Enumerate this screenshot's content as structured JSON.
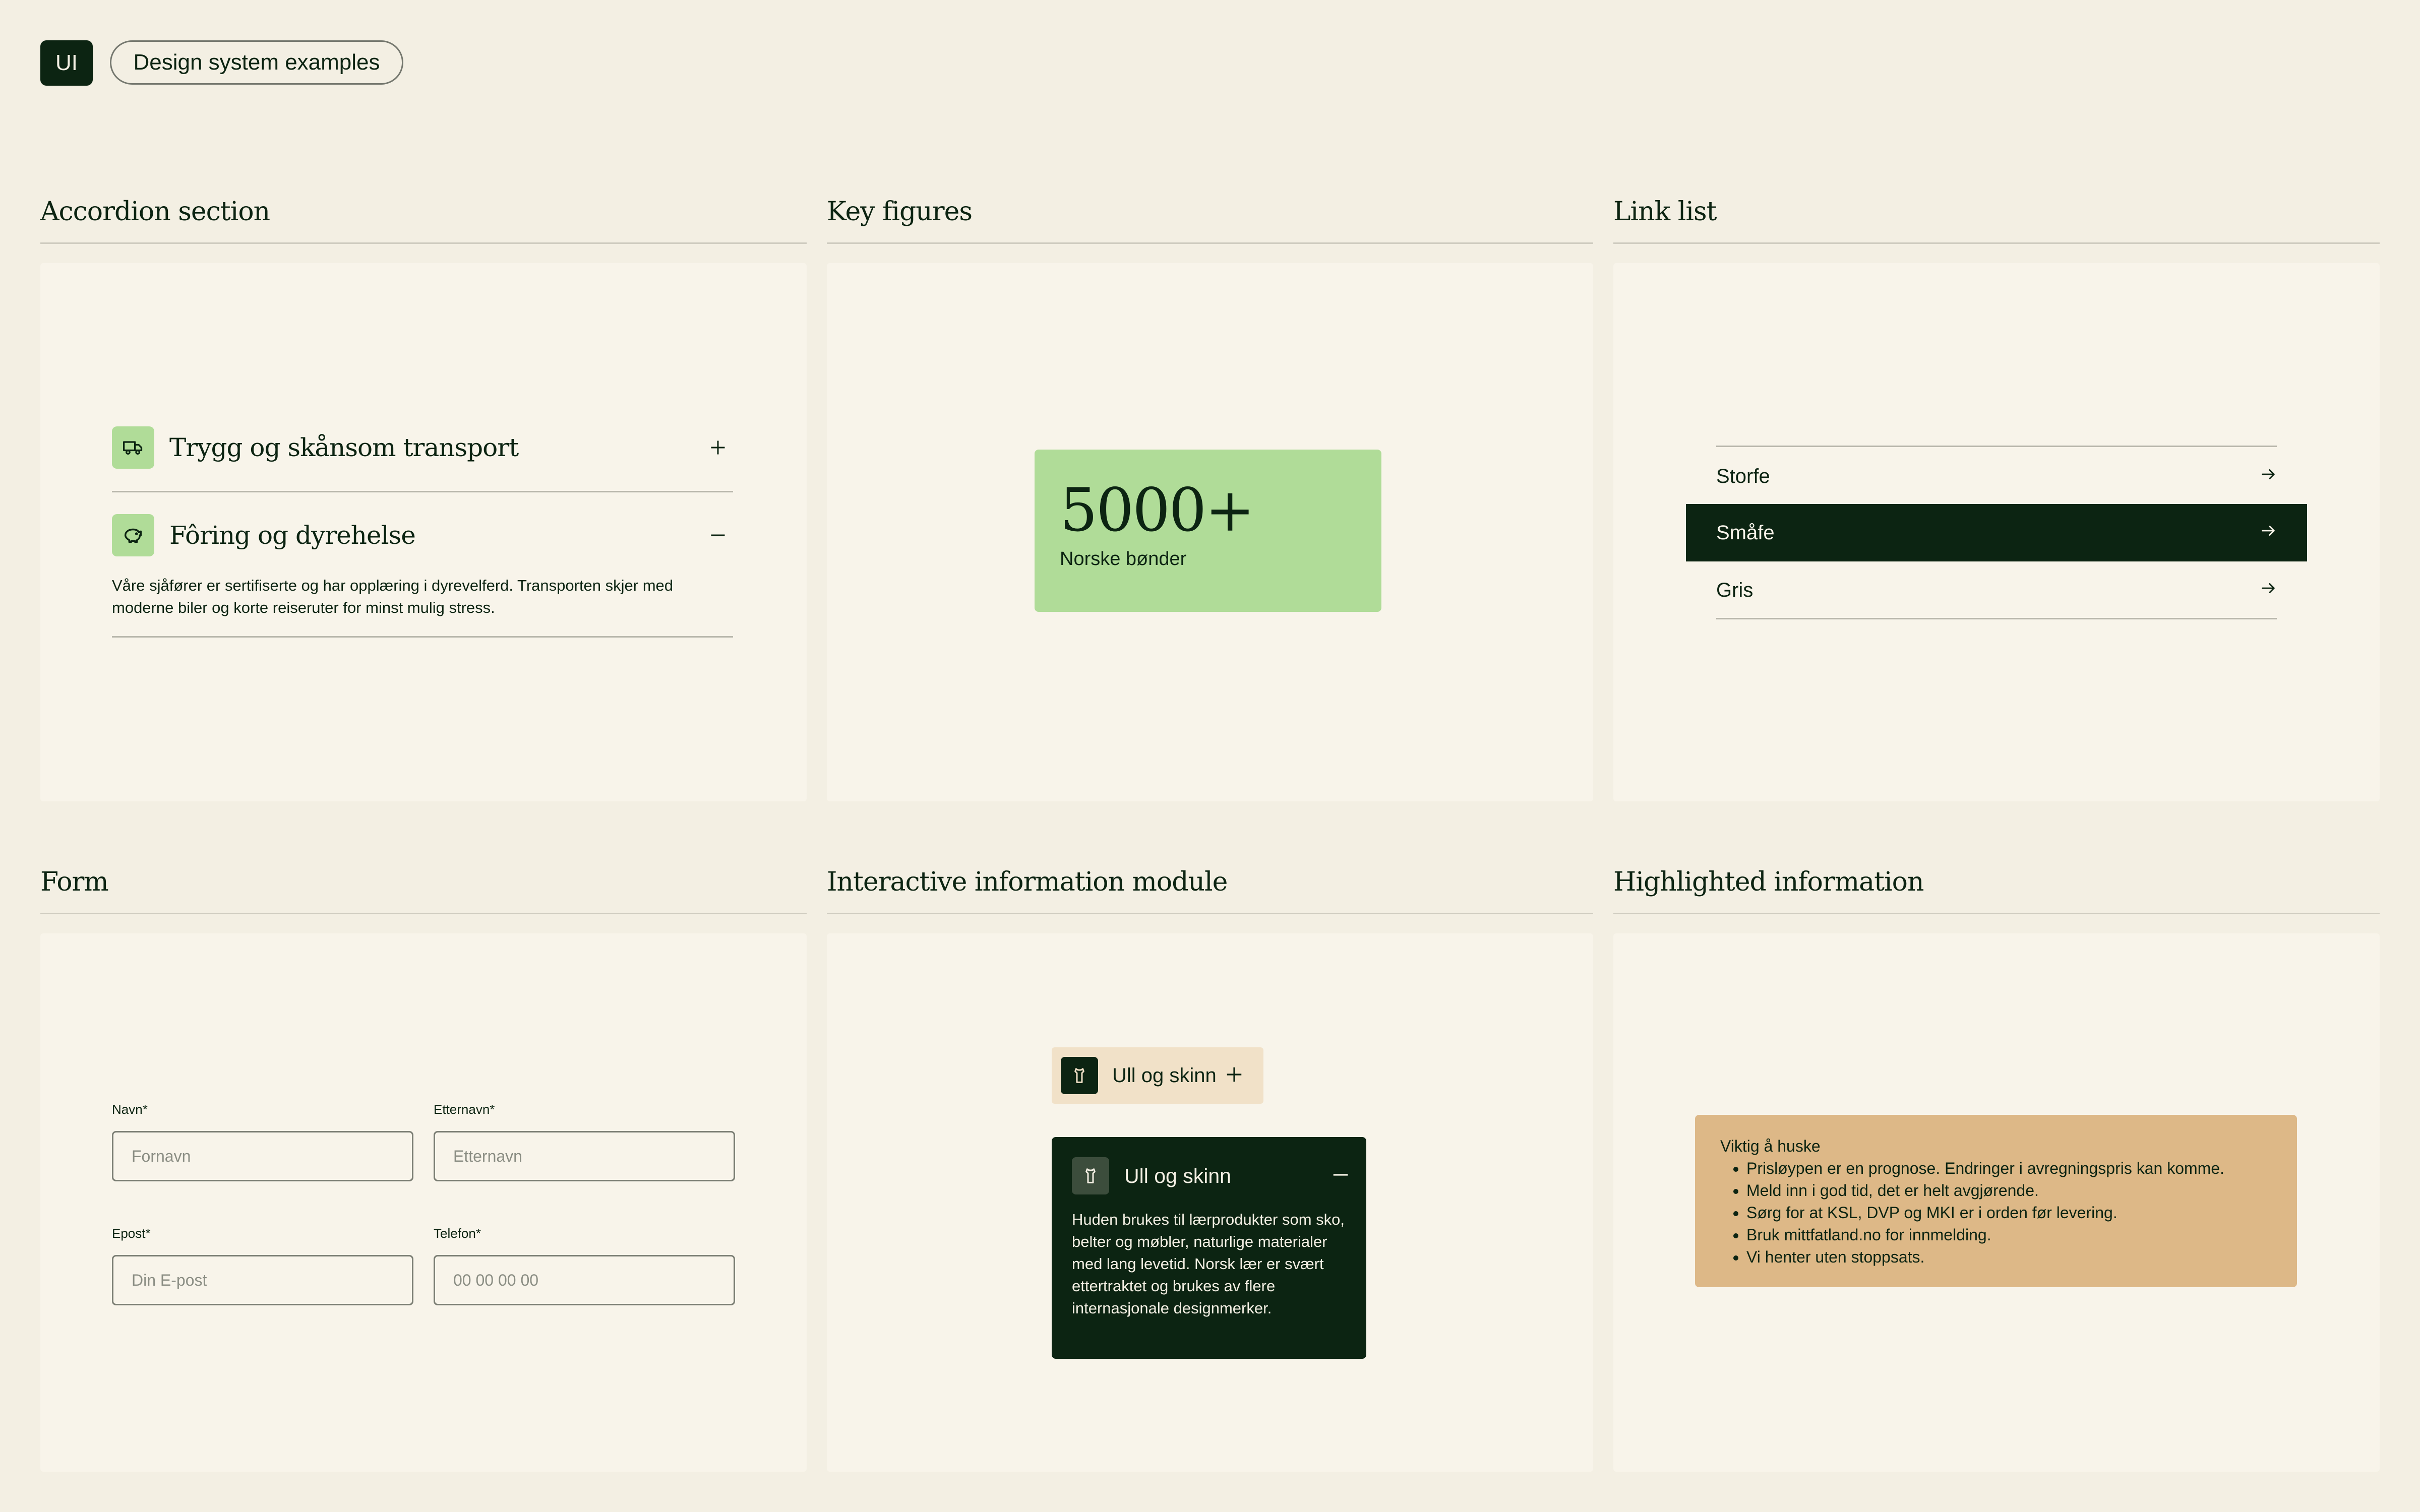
{
  "header": {
    "logo_text": "UI",
    "pill_label": "Design system examples"
  },
  "sections": {
    "accordion": "Accordion section",
    "key_figures": "Key figures",
    "link_list": "Link list",
    "form": "Form",
    "info_module": "Interactive information module",
    "highlighted": "Highlighted information"
  },
  "accordion": {
    "items": [
      {
        "icon": "truck-icon",
        "title": "Trygg og skånsom transport",
        "expanded": false
      },
      {
        "icon": "pig-icon",
        "title": "Fôring og dyrehelse",
        "expanded": true,
        "body": "Våre sjåfører er sertifiserte og har opplæring i dyrevelferd. Transporten skjer med moderne biler og korte reiseruter for minst mulig stress."
      }
    ]
  },
  "key_figure": {
    "value": "5000+",
    "label": "Norske bønder"
  },
  "link_list": {
    "items": [
      {
        "label": "Storfe",
        "active": false
      },
      {
        "label": "Småfe",
        "active": true
      },
      {
        "label": "Gris",
        "active": false
      }
    ]
  },
  "form": {
    "first_name": {
      "label": "Navn*",
      "placeholder": "Fornavn"
    },
    "last_name": {
      "label": "Etternavn*",
      "placeholder": "Etternavn"
    },
    "email": {
      "label": "Epost*",
      "placeholder": "Din E-post"
    },
    "phone": {
      "label": "Telefon*",
      "placeholder": "00 00 00 00"
    }
  },
  "info_module": {
    "collapsed_label": "Ull og skinn",
    "expanded_title": "Ull og skinn",
    "expanded_body": "Huden brukes til lærprodukter som sko, belter og møbler, naturlige materialer med lang levetid. Norsk lær er svært ettertraktet og brukes av flere internasjonale designmerker."
  },
  "highlighted": {
    "title": "Viktig å huske",
    "items": [
      "Prisløypen er en prognose. Endringer i avregningspris kan komme.",
      "Meld inn i god tid, det er helt avgjørende.",
      "Sørg for at KSL, DVP og MKI er i orden før levering.",
      "Bruk mittfatland.no for innmelding.",
      "Vi henter uten stoppsats."
    ]
  },
  "colors": {
    "background": "#f3efe3",
    "panel": "#f8f4ea",
    "dark_green": "#0c2412",
    "light_green": "#b0dc98",
    "tan": "#ddb887",
    "chip_beige": "#f1e1c8"
  }
}
